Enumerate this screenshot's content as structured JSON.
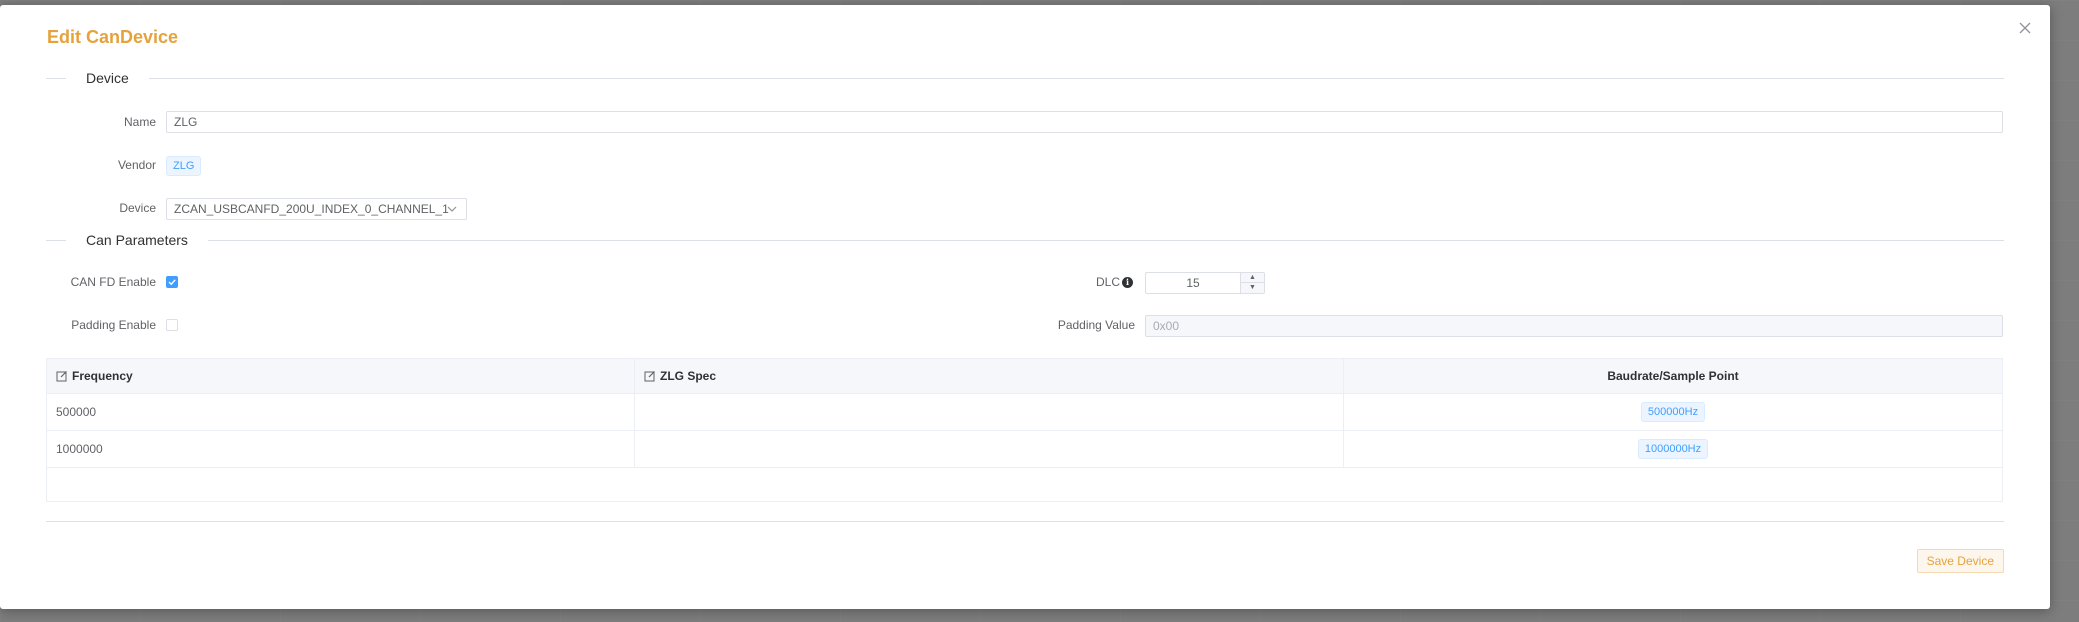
{
  "dialog": {
    "title": "Edit CanDevice",
    "close_icon": "close-icon"
  },
  "device_section": {
    "label": "Device",
    "name_label": "Name",
    "name_value": "ZLG",
    "vendor_label": "Vendor",
    "vendor_tag": "ZLG",
    "device_label": "Device",
    "device_value": "ZCAN_USBCANFD_200U_INDEX_0_CHANNEL_1"
  },
  "can_section": {
    "label": "Can Parameters",
    "canfd_label": "CAN FD Enable",
    "canfd_checked": true,
    "dlc_label": "DLC",
    "dlc_value": "15",
    "padding_label": "Padding Enable",
    "padding_checked": false,
    "padding_value_label": "Padding Value",
    "padding_value_placeholder": "0x00"
  },
  "table": {
    "columns": [
      "Frequency",
      "ZLG Spec",
      "Baudrate/Sample Point"
    ],
    "rows": [
      {
        "frequency": "500000",
        "spec": "",
        "baudrate": "500000Hz"
      },
      {
        "frequency": "1000000",
        "spec": "",
        "baudrate": "1000000Hz"
      }
    ]
  },
  "footer": {
    "save_label": "Save Device"
  },
  "colors": {
    "accent": "#e6a23c",
    "primary": "#409eff"
  }
}
